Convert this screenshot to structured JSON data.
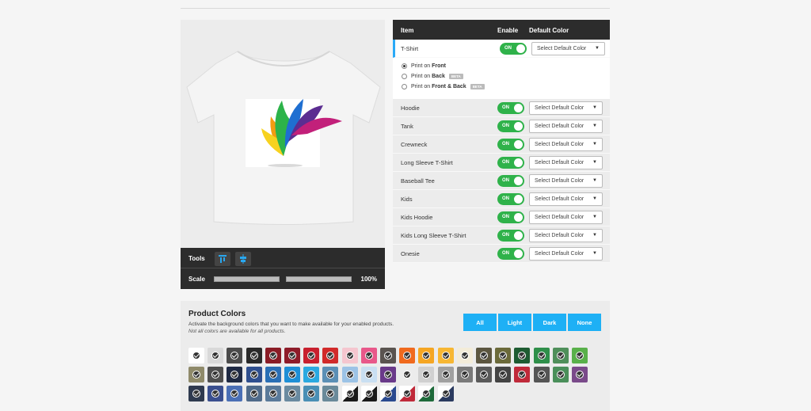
{
  "preview": {
    "tools_label": "Tools",
    "scale_label": "Scale",
    "scale_value": "100%"
  },
  "table": {
    "headers": {
      "item": "Item",
      "enable": "Enable",
      "default_color": "Default Color"
    },
    "toggle_label": "ON",
    "select_placeholder": "Select Default Color",
    "items": [
      "T-Shirt",
      "Hoodie",
      "Tank",
      "Crewneck",
      "Long Sleeve T-Shirt",
      "Baseball Tee",
      "Kids",
      "Kids Hoodie",
      "Kids Long Sleeve T-Shirt",
      "Onesie"
    ],
    "print_options": [
      {
        "prefix": "Print on",
        "target": "Front",
        "selected": true,
        "beta": ""
      },
      {
        "prefix": "Print on",
        "target": "Back",
        "selected": false,
        "beta": "BETA"
      },
      {
        "prefix": "Print on",
        "target": "Front & Back",
        "selected": false,
        "beta": "BETA"
      }
    ]
  },
  "product_colors": {
    "title": "Product Colors",
    "description": "Activate the background colors that you want to make available for your enabled products.",
    "note": "Not all colors are available for all products.",
    "filters": [
      "All",
      "Light",
      "Dark",
      "None"
    ],
    "swatches": [
      [
        "#ffffff",
        "#d9d9d9",
        "#4b4b4b",
        "#2a2a2a",
        "#8a1c26",
        "#8e1c2a",
        "#c8202e",
        "#d12a2a",
        "#f5c6cf",
        "#e8588a",
        "#5a5450",
        "#f06a1e",
        "#f5a623",
        "#f7b733",
        "#f3ecd9",
        "#5c5640",
        "#6b6a3a",
        "#1e5c32",
        "#2f8f4a",
        "#4f8f5a",
        "#59b04a"
      ],
      [
        "#8f8a6a",
        "#4f4f4f",
        "#1f2a44",
        "#2f4f8f",
        "#2a6fb5",
        "#1e8fd6",
        "#2aa9e0",
        "#5b8fb5",
        "#9cc3e6",
        "#c9dff2",
        "#6a3a8a",
        "#ececec",
        "#d0d0d0",
        "#a0a0a0",
        "#7a7a7a",
        "#5a5a5a",
        "#444444",
        "#c02a3a",
        "#555555",
        "#4a8f5a",
        "#7a4a8a"
      ],
      [
        "#2f3a4f",
        "#3a4f8f",
        "#4a6fb5",
        "#4f6a8a",
        "#5a7a9a",
        "#6a8aa0",
        "#4a8fb5",
        "#6a8a9a",
        "#1a1a1a",
        "#1a1a1a",
        "#2a4a8f",
        "#c02a3a",
        "#1e6a3a",
        "#2a3a5f"
      ]
    ],
    "split_swatches": [
      8,
      9,
      10,
      11,
      12,
      13
    ]
  }
}
